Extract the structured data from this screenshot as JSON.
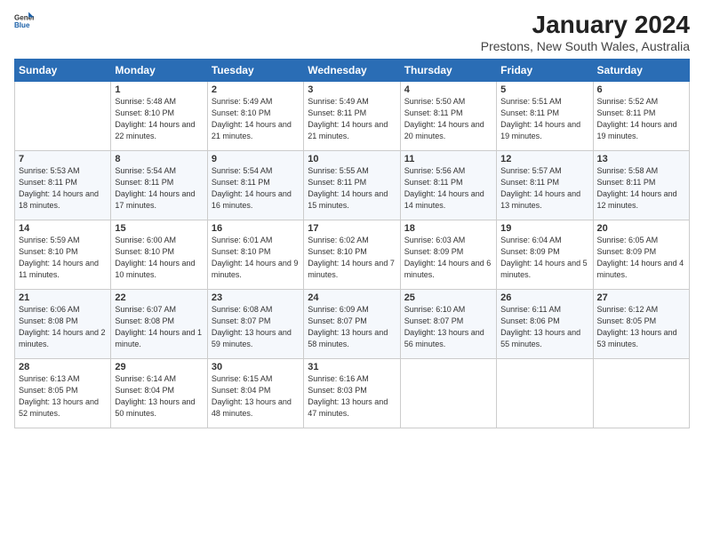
{
  "logo": {
    "text_general": "General",
    "text_blue": "Blue"
  },
  "title": "January 2024",
  "subtitle": "Prestons, New South Wales, Australia",
  "headers": [
    "Sunday",
    "Monday",
    "Tuesday",
    "Wednesday",
    "Thursday",
    "Friday",
    "Saturday"
  ],
  "weeks": [
    [
      {
        "day": "",
        "sunrise": "",
        "sunset": "",
        "daylight": ""
      },
      {
        "day": "1",
        "sunrise": "Sunrise: 5:48 AM",
        "sunset": "Sunset: 8:10 PM",
        "daylight": "Daylight: 14 hours and 22 minutes."
      },
      {
        "day": "2",
        "sunrise": "Sunrise: 5:49 AM",
        "sunset": "Sunset: 8:10 PM",
        "daylight": "Daylight: 14 hours and 21 minutes."
      },
      {
        "day": "3",
        "sunrise": "Sunrise: 5:49 AM",
        "sunset": "Sunset: 8:11 PM",
        "daylight": "Daylight: 14 hours and 21 minutes."
      },
      {
        "day": "4",
        "sunrise": "Sunrise: 5:50 AM",
        "sunset": "Sunset: 8:11 PM",
        "daylight": "Daylight: 14 hours and 20 minutes."
      },
      {
        "day": "5",
        "sunrise": "Sunrise: 5:51 AM",
        "sunset": "Sunset: 8:11 PM",
        "daylight": "Daylight: 14 hours and 19 minutes."
      },
      {
        "day": "6",
        "sunrise": "Sunrise: 5:52 AM",
        "sunset": "Sunset: 8:11 PM",
        "daylight": "Daylight: 14 hours and 19 minutes."
      }
    ],
    [
      {
        "day": "7",
        "sunrise": "Sunrise: 5:53 AM",
        "sunset": "Sunset: 8:11 PM",
        "daylight": "Daylight: 14 hours and 18 minutes."
      },
      {
        "day": "8",
        "sunrise": "Sunrise: 5:54 AM",
        "sunset": "Sunset: 8:11 PM",
        "daylight": "Daylight: 14 hours and 17 minutes."
      },
      {
        "day": "9",
        "sunrise": "Sunrise: 5:54 AM",
        "sunset": "Sunset: 8:11 PM",
        "daylight": "Daylight: 14 hours and 16 minutes."
      },
      {
        "day": "10",
        "sunrise": "Sunrise: 5:55 AM",
        "sunset": "Sunset: 8:11 PM",
        "daylight": "Daylight: 14 hours and 15 minutes."
      },
      {
        "day": "11",
        "sunrise": "Sunrise: 5:56 AM",
        "sunset": "Sunset: 8:11 PM",
        "daylight": "Daylight: 14 hours and 14 minutes."
      },
      {
        "day": "12",
        "sunrise": "Sunrise: 5:57 AM",
        "sunset": "Sunset: 8:11 PM",
        "daylight": "Daylight: 14 hours and 13 minutes."
      },
      {
        "day": "13",
        "sunrise": "Sunrise: 5:58 AM",
        "sunset": "Sunset: 8:11 PM",
        "daylight": "Daylight: 14 hours and 12 minutes."
      }
    ],
    [
      {
        "day": "14",
        "sunrise": "Sunrise: 5:59 AM",
        "sunset": "Sunset: 8:10 PM",
        "daylight": "Daylight: 14 hours and 11 minutes."
      },
      {
        "day": "15",
        "sunrise": "Sunrise: 6:00 AM",
        "sunset": "Sunset: 8:10 PM",
        "daylight": "Daylight: 14 hours and 10 minutes."
      },
      {
        "day": "16",
        "sunrise": "Sunrise: 6:01 AM",
        "sunset": "Sunset: 8:10 PM",
        "daylight": "Daylight: 14 hours and 9 minutes."
      },
      {
        "day": "17",
        "sunrise": "Sunrise: 6:02 AM",
        "sunset": "Sunset: 8:10 PM",
        "daylight": "Daylight: 14 hours and 7 minutes."
      },
      {
        "day": "18",
        "sunrise": "Sunrise: 6:03 AM",
        "sunset": "Sunset: 8:09 PM",
        "daylight": "Daylight: 14 hours and 6 minutes."
      },
      {
        "day": "19",
        "sunrise": "Sunrise: 6:04 AM",
        "sunset": "Sunset: 8:09 PM",
        "daylight": "Daylight: 14 hours and 5 minutes."
      },
      {
        "day": "20",
        "sunrise": "Sunrise: 6:05 AM",
        "sunset": "Sunset: 8:09 PM",
        "daylight": "Daylight: 14 hours and 4 minutes."
      }
    ],
    [
      {
        "day": "21",
        "sunrise": "Sunrise: 6:06 AM",
        "sunset": "Sunset: 8:08 PM",
        "daylight": "Daylight: 14 hours and 2 minutes."
      },
      {
        "day": "22",
        "sunrise": "Sunrise: 6:07 AM",
        "sunset": "Sunset: 8:08 PM",
        "daylight": "Daylight: 14 hours and 1 minute."
      },
      {
        "day": "23",
        "sunrise": "Sunrise: 6:08 AM",
        "sunset": "Sunset: 8:07 PM",
        "daylight": "Daylight: 13 hours and 59 minutes."
      },
      {
        "day": "24",
        "sunrise": "Sunrise: 6:09 AM",
        "sunset": "Sunset: 8:07 PM",
        "daylight": "Daylight: 13 hours and 58 minutes."
      },
      {
        "day": "25",
        "sunrise": "Sunrise: 6:10 AM",
        "sunset": "Sunset: 8:07 PM",
        "daylight": "Daylight: 13 hours and 56 minutes."
      },
      {
        "day": "26",
        "sunrise": "Sunrise: 6:11 AM",
        "sunset": "Sunset: 8:06 PM",
        "daylight": "Daylight: 13 hours and 55 minutes."
      },
      {
        "day": "27",
        "sunrise": "Sunrise: 6:12 AM",
        "sunset": "Sunset: 8:05 PM",
        "daylight": "Daylight: 13 hours and 53 minutes."
      }
    ],
    [
      {
        "day": "28",
        "sunrise": "Sunrise: 6:13 AM",
        "sunset": "Sunset: 8:05 PM",
        "daylight": "Daylight: 13 hours and 52 minutes."
      },
      {
        "day": "29",
        "sunrise": "Sunrise: 6:14 AM",
        "sunset": "Sunset: 8:04 PM",
        "daylight": "Daylight: 13 hours and 50 minutes."
      },
      {
        "day": "30",
        "sunrise": "Sunrise: 6:15 AM",
        "sunset": "Sunset: 8:04 PM",
        "daylight": "Daylight: 13 hours and 48 minutes."
      },
      {
        "day": "31",
        "sunrise": "Sunrise: 6:16 AM",
        "sunset": "Sunset: 8:03 PM",
        "daylight": "Daylight: 13 hours and 47 minutes."
      },
      {
        "day": "",
        "sunrise": "",
        "sunset": "",
        "daylight": ""
      },
      {
        "day": "",
        "sunrise": "",
        "sunset": "",
        "daylight": ""
      },
      {
        "day": "",
        "sunrise": "",
        "sunset": "",
        "daylight": ""
      }
    ]
  ]
}
